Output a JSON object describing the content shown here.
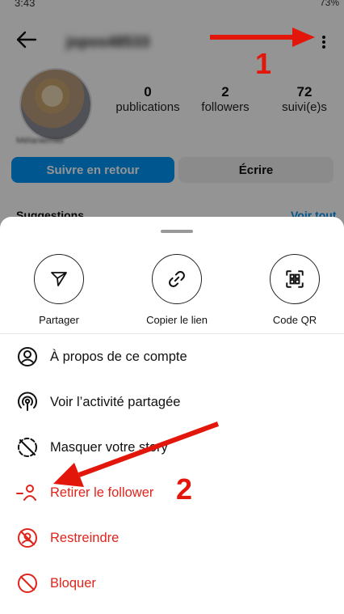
{
  "status_bar": {
    "time": "3:43",
    "right": "73%"
  },
  "profile": {
    "username": "jopos48533",
    "display_name": "Mélaniemiel",
    "stats": [
      {
        "value": "0",
        "label": "publications"
      },
      {
        "value": "2",
        "label": "followers"
      },
      {
        "value": "72",
        "label": "suivi(e)s"
      }
    ],
    "follow_back_label": "Suivre en retour",
    "message_label": "Écrire",
    "suggestions_label": "Suggestions",
    "see_all_label": "Voir tout"
  },
  "sheet": {
    "actions": [
      {
        "label": "Partager",
        "icon": "send-icon"
      },
      {
        "label": "Copier le lien",
        "icon": "link-icon"
      },
      {
        "label": "Code QR",
        "icon": "qr-code-icon"
      }
    ],
    "items": [
      {
        "label": "À propos de ce compte",
        "icon": "account-info-icon",
        "danger": false
      },
      {
        "label": "Voir l’activité partagée",
        "icon": "activity-icon",
        "danger": false
      },
      {
        "label": "Masquer votre story",
        "icon": "hide-story-icon",
        "danger": false
      },
      {
        "label": "Retirer le follower",
        "icon": "remove-follower-icon",
        "danger": true
      },
      {
        "label": "Restreindre",
        "icon": "restrict-icon",
        "danger": true
      },
      {
        "label": "Bloquer",
        "icon": "block-icon",
        "danger": true
      }
    ]
  },
  "annotations": {
    "step1": "1",
    "step2": "2",
    "color": "#e3160b"
  },
  "colors": {
    "accent": "#0095f6",
    "danger": "#e0241b"
  }
}
